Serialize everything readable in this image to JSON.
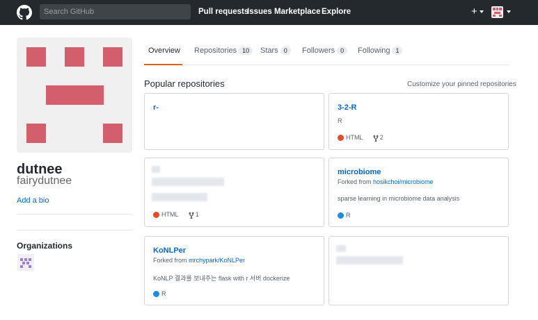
{
  "header": {
    "search_placeholder": "Search GitHub",
    "nav": [
      "Pull requests",
      "Issues",
      "Marketplace",
      "Explore"
    ],
    "plus_label": "+"
  },
  "profile": {
    "name": "dutnee",
    "login": "fairydutnee",
    "add_bio": "Add a bio",
    "orgs_title": "Organizations"
  },
  "tabs": [
    {
      "label": "Overview"
    },
    {
      "label": "Repositories",
      "count": "10"
    },
    {
      "label": "Stars",
      "count": "0"
    },
    {
      "label": "Followers",
      "count": "0"
    },
    {
      "label": "Following",
      "count": "1"
    }
  ],
  "popular": {
    "title": "Popular repositories",
    "customize": "Customize your pinned repositories"
  },
  "repos": [
    {
      "name": "r-"
    },
    {
      "name": "3-2-R",
      "description": "R",
      "language": "HTML",
      "forks": "2"
    },
    {
      "language": "HTML",
      "forks": "1"
    },
    {
      "name": "microbiome",
      "forked_prefix": "Forked from",
      "forked_from": "hosikchoi/microbiome",
      "description": "sparse learning in microbiome data analysis",
      "language": "R"
    },
    {
      "name": "KoNLPer",
      "forked_prefix": "Forked from",
      "forked_from": "mrchypark/KoNLPer",
      "description": "KoNLP 결과를 보내주는 flask with r 서버 dockerize",
      "language": "R"
    },
    {}
  ],
  "colors": {
    "html": "#e34c26",
    "r": "#198ce7",
    "accent": "#e36209",
    "link": "#0366d6"
  }
}
